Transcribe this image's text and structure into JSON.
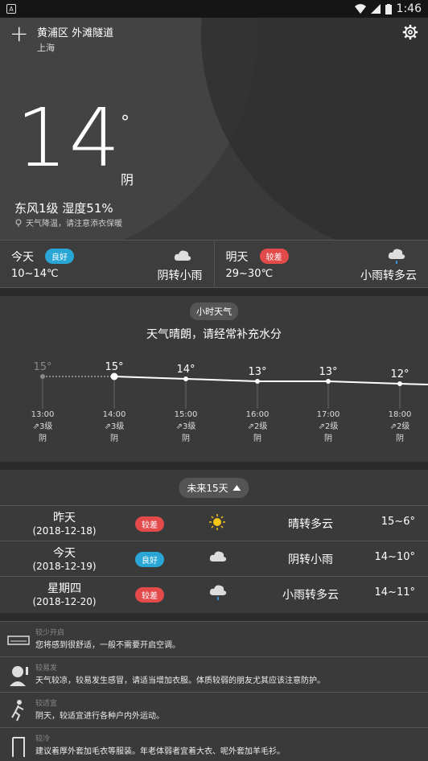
{
  "status": {
    "time": "1:46"
  },
  "header": {
    "district": "黄浦区 外滩隧道",
    "city": "上海"
  },
  "current": {
    "temperature": "14",
    "degree_symbol": "°",
    "condition": "阴",
    "wind_humidity": "东风1级  湿度51%",
    "tip": "天气降温，请注意添衣保暖"
  },
  "today": {
    "label": "今天",
    "quality": "良好",
    "range": "10~14℃",
    "desc": "阴转小雨",
    "icon": "cloud-icon"
  },
  "tomorrow": {
    "label": "明天",
    "quality": "较差",
    "range": "29~30℃",
    "desc": "小雨转多云",
    "icon": "rain-cloud-icon"
  },
  "hourly": {
    "title": "小时天气",
    "subtitle": "天气晴朗，请经常补充水分",
    "points": [
      {
        "temp": "15°",
        "time": "13:00",
        "wind": "3级",
        "cond": "阴"
      },
      {
        "temp": "15°",
        "time": "14:00",
        "wind": "3级",
        "cond": "阴"
      },
      {
        "temp": "14°",
        "time": "15:00",
        "wind": "3级",
        "cond": "阴"
      },
      {
        "temp": "13°",
        "time": "16:00",
        "wind": "2级",
        "cond": "阴"
      },
      {
        "temp": "13°",
        "time": "17:00",
        "wind": "2级",
        "cond": "阴"
      },
      {
        "temp": "12°",
        "time": "18:00",
        "wind": "2级",
        "cond": "阴"
      }
    ]
  },
  "forecast": {
    "toggle_label": "未来15天",
    "rows": [
      {
        "day": "昨天",
        "date": "(2018-12-18)",
        "quality": "较差",
        "desc": "晴转多云",
        "temp": "15~6°",
        "icon": "sun-icon"
      },
      {
        "day": "今天",
        "date": "(2018-12-19)",
        "quality": "良好",
        "desc": "阴转小雨",
        "temp": "14~10°",
        "icon": "cloud-icon"
      },
      {
        "day": "星期四",
        "date": "(2018-12-20)",
        "quality": "较差",
        "desc": "小雨转多云",
        "temp": "14~11°",
        "icon": "rain-cloud-icon"
      }
    ]
  },
  "tips": [
    {
      "label": "较少开启",
      "desc": "您将感到很舒适，一般不需要开启空调。",
      "icon": "air-conditioner-icon"
    },
    {
      "label": "较易发",
      "desc": "天气较凉，较易发生感冒，请适当增加衣服。体质较弱的朋友尤其应该注意防护。",
      "icon": "sick-person-icon"
    },
    {
      "label": "较适宜",
      "desc": "阴天，较适宜进行各种户内外运动。",
      "icon": "running-icon"
    },
    {
      "label": "较冷",
      "desc": "建议着厚外套加毛衣等服装。年老体弱者宜着大衣、呢外套加羊毛衫。",
      "icon": "clothes-icon"
    }
  ]
}
